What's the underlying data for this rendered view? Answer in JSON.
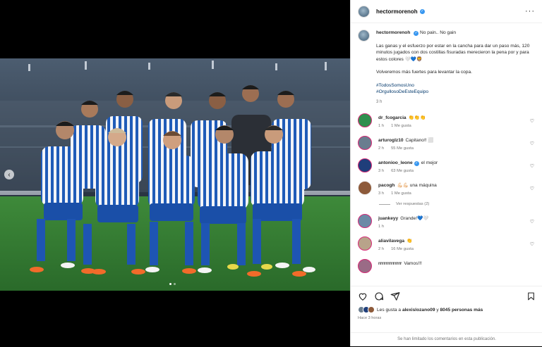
{
  "header": {
    "username": "hectormorenoh",
    "more_icon": "more-horizontal-icon"
  },
  "caption": {
    "username": "hectormorenoh",
    "lead": "No pain.. No gain",
    "paragraph": "Las ganas y el esfuerzo por estar en la cancha para dar un paso más, 120 minutos jugados con dos costillas fisuradas merecieron la pena por y para estos colores 🤍💙🦁",
    "line2": "Volveremos más fuertes para levantar la copa.",
    "tag1": "#TodosSomosUno",
    "tag2": "#OrgullosoDeEsteEquipo",
    "time": "3 h"
  },
  "comments": [
    {
      "user": "dr_fcogarcia",
      "text": "👏👏👏",
      "time": "1 h",
      "likes": "1 Me gusta",
      "color": "#2f8f4e"
    },
    {
      "user": "arturoglz10",
      "text": "Capitano!! ⬜",
      "time": "2 h",
      "likes": "55 Me gusta",
      "color": "#6a7d8f"
    },
    {
      "user": "antonioo_leone",
      "text": "el mejor",
      "time": "3 h",
      "likes": "63 Me gusta",
      "color": "#1f3e7a",
      "verified": true
    },
    {
      "user": "pacogh",
      "text": "💪🏻💪🏻 una máquina",
      "time": "3 h",
      "likes": "1 Me gusta",
      "color": "#8d5a3a"
    },
    {
      "user": "juankeyy",
      "text": "Grande!💙🤍",
      "time": "1 h",
      "likes": "",
      "color": "#6c8aa6"
    },
    {
      "user": "aliavilavega",
      "text": "👏",
      "time": "2 h",
      "likes": "16 Me gusta",
      "color": "#b8a38a"
    },
    {
      "user": "rrrrrrrrrrrrr",
      "text": "Vamos!!!",
      "time": "",
      "likes": "",
      "color": "#9a6b86"
    }
  ],
  "view_replies": "Ver respuestas (2)",
  "actions": {
    "like_icon": "heart-outline-icon",
    "comment_icon": "comment-icon",
    "share_icon": "paper-plane-icon",
    "save_icon": "bookmark-icon"
  },
  "likes": {
    "prefix": "Les gusta a",
    "user": "alexislozano09",
    "middle": "y",
    "count": "8045 personas más"
  },
  "posted": "Hace 3 horas",
  "comments_limited": "Se han limitado los comentarios en esta publicación."
}
